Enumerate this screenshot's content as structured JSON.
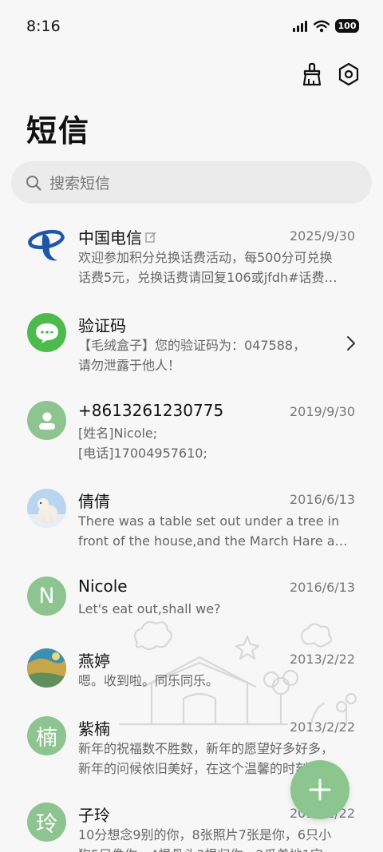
{
  "status_bar": {
    "time": "8:16",
    "battery": "100"
  },
  "header": {
    "title": "短信",
    "icons": [
      "cleanup-brush-icon",
      "settings-hexagon-icon"
    ]
  },
  "search": {
    "placeholder": "搜索短信"
  },
  "conversations": [
    {
      "name": "中国电信",
      "date": "2025/9/30",
      "line1": "欢迎参加积分兑换话费活动，每500分可兑换",
      "line2": "话费5元，兑换话费请回复106或jfdh#话费…",
      "avatar": "china-telecom-logo",
      "badge": "edit-icon"
    },
    {
      "name": "验证码",
      "date": "",
      "line1": "【毛绒盒子】您的验证码为：047588，",
      "line2": "请勿泄露于他人！",
      "avatar": "sms-bubble-icon"
    },
    {
      "name": "+8613261230775",
      "date": "2019/9/30",
      "line1": "[姓名]Nicole;",
      "line2": "[电话]17004957610;",
      "avatar": "person-icon"
    },
    {
      "name": "倩倩",
      "date": "2016/6/13",
      "line1": "There was a table set out under a tree in",
      "line2": "front of the house,and the March Hare an…",
      "avatar": "polar-bear-photo"
    },
    {
      "name": "Nicole",
      "date": "2016/6/13",
      "line1": "Let's eat out,shall we?",
      "line2": "",
      "avatar": "N"
    },
    {
      "name": "燕婷",
      "date": "2013/2/22",
      "line1": "嗯。收到啦。同乐同乐。",
      "line2": "",
      "avatar": "landscape-photo"
    },
    {
      "name": "紫楠",
      "date": "2013/2/22",
      "line1": "新年的祝福数不胜数，新年的愿望好多好多，",
      "line2": "新年的问候依旧美好，在这个温馨的时刻…",
      "avatar": "楠"
    },
    {
      "name": "子玲",
      "date": "2013/2/22",
      "line1": "10分想念9别的你，8张照片7张是你，6只小",
      "line2": "狗5只像你，4根骨头3根归你，2瓜着地1宝",
      "avatar": "玲"
    }
  ],
  "fab": {
    "icon": "plus-icon"
  },
  "colors": {
    "accent_green": "#8cc68e",
    "telecom_blue": "#1f56a8",
    "sms_green": "#4cbb4c"
  }
}
